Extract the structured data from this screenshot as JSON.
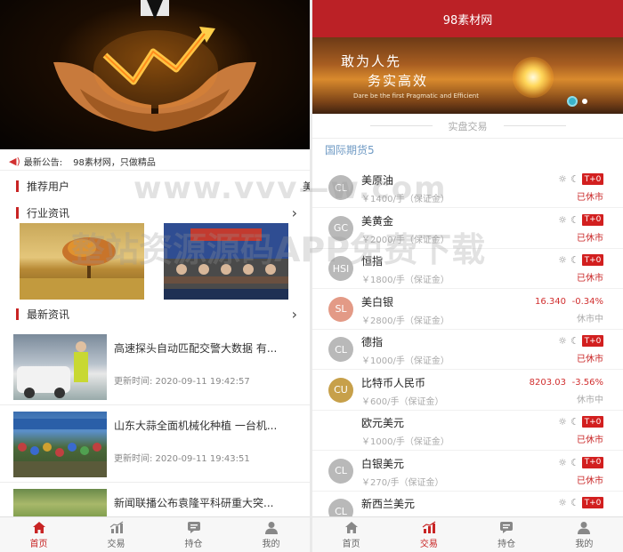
{
  "left": {
    "notice": {
      "label": "最新公告:",
      "text": "98素材网，只做精品"
    },
    "sections": {
      "recommended": "推荐用户",
      "recommended_peek": "美",
      "industry": "行业资讯",
      "latest": "最新资讯"
    },
    "news": [
      {
        "title": "高速探头自动匹配交警大数据 有...",
        "time": "更新时间: 2020-09-11 19:42:57"
      },
      {
        "title": "山东大蒜全面机械化种植 一台机...",
        "time": "更新时间: 2020-09-11 19:43:51"
      },
      {
        "title": "新闻联播公布袁隆平科研重大突...",
        "time": ""
      }
    ],
    "tabs": [
      "首页",
      "交易",
      "持仓",
      "我的"
    ]
  },
  "right": {
    "header_title": "98素材网",
    "banner": {
      "line1": "敢为人先",
      "line2": "务实高效",
      "line3": "Dare be the first  Pragmatic and Efficient"
    },
    "subtitle": "实盘交易",
    "category": "国际期货5",
    "products": [
      {
        "abbr": "CL",
        "name": "美原油",
        "note": "￥1400/手（保证金）",
        "badge": "T+0",
        "status": "已休市",
        "color": "#b9b9b9"
      },
      {
        "abbr": "GC",
        "name": "美黄金",
        "note": "￥2000/手（保证金）",
        "badge": "T+0",
        "status": "已休市",
        "color": "#b9b9b9"
      },
      {
        "abbr": "HSI",
        "name": "恒指",
        "note": "￥1800/手（保证金）",
        "badge": "T+0",
        "status": "已休市",
        "color": "#b9b9b9"
      },
      {
        "abbr": "SL",
        "name": "美白银",
        "note": "￥2800/手（保证金）",
        "price": "16.340",
        "change": "-0.34%",
        "status": "休市中",
        "color": "#e39a86"
      },
      {
        "abbr": "CL",
        "name": "德指",
        "note": "￥1000/手（保证金）",
        "badge": "T+0",
        "status": "已休市",
        "color": "#b9b9b9"
      },
      {
        "abbr": "CU",
        "name": "比特币人民币",
        "note": "￥600/手（保证金）",
        "price": "8203.03",
        "change": "-3.56%",
        "status": "休市中",
        "color": "#c7a04a"
      },
      {
        "abbr": "",
        "name": "欧元美元",
        "note": "￥1000/手（保证金）",
        "badge": "T+0",
        "status": "已休市",
        "color": "#ffffff"
      },
      {
        "abbr": "CL",
        "name": "白银美元",
        "note": "￥270/手（保证金）",
        "badge": "T+0",
        "status": "已休市",
        "color": "#b9b9b9"
      },
      {
        "abbr": "CL",
        "name": "新西兰美元",
        "note": "",
        "badge": "T+0",
        "status": "",
        "color": "#b9b9b9"
      }
    ],
    "tabs": [
      "首页",
      "交易",
      "持仓",
      "我的"
    ]
  },
  "watermark": {
    "line1": "www.vvv—w.com",
    "line2": "整站资源源码APP免费下载"
  },
  "colors": {
    "primary": "#bb2126",
    "accent": "#c82424",
    "category": "#6f9ac4"
  }
}
